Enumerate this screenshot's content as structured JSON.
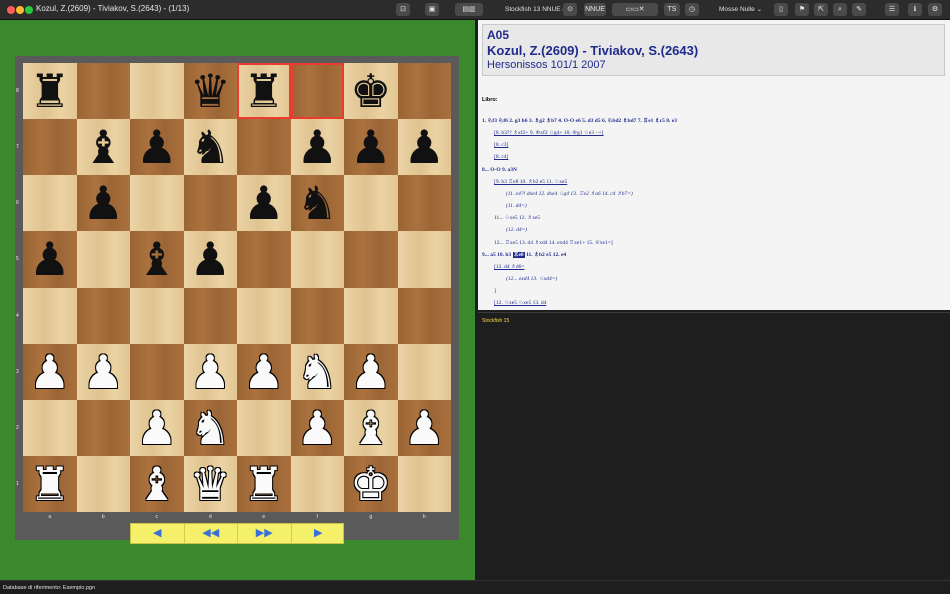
{
  "window": {
    "title": "Kozul, Z.(2609) - Tiviakov, S.(2643) - (1/13)"
  },
  "toolbar": {
    "engine_select": "Stockfish 13 NNUE ◇",
    "nnue_label": "NNUE",
    "ts_label": "TS",
    "mode_select": "Mosse Nulle ⌄"
  },
  "board": {
    "files": [
      "a",
      "b",
      "c",
      "d",
      "e",
      "f",
      "g",
      "h"
    ],
    "ranks": [
      "8",
      "7",
      "6",
      "5",
      "4",
      "3",
      "2",
      "1"
    ],
    "highlight_squares": [
      "e8",
      "f8"
    ],
    "pieces": [
      {
        "sq": "a8",
        "color": "b",
        "glyph": "♜",
        "name": "black-rook-icon"
      },
      {
        "sq": "d8",
        "color": "b",
        "glyph": "♛",
        "name": "black-queen-icon"
      },
      {
        "sq": "e8",
        "color": "b",
        "glyph": "♜",
        "name": "black-rook-icon"
      },
      {
        "sq": "g8",
        "color": "b",
        "glyph": "♚",
        "name": "black-king-icon"
      },
      {
        "sq": "b7",
        "color": "b",
        "glyph": "♝",
        "name": "black-bishop-icon"
      },
      {
        "sq": "c7",
        "color": "b",
        "glyph": "♟",
        "name": "black-pawn-icon"
      },
      {
        "sq": "d7",
        "color": "b",
        "glyph": "♞",
        "name": "black-knight-icon"
      },
      {
        "sq": "f7",
        "color": "b",
        "glyph": "♟",
        "name": "black-pawn-icon"
      },
      {
        "sq": "g7",
        "color": "b",
        "glyph": "♟",
        "name": "black-pawn-icon"
      },
      {
        "sq": "h7",
        "color": "b",
        "glyph": "♟",
        "name": "black-pawn-icon"
      },
      {
        "sq": "b6",
        "color": "b",
        "glyph": "♟",
        "name": "black-pawn-icon"
      },
      {
        "sq": "e6",
        "color": "b",
        "glyph": "♟",
        "name": "black-pawn-icon"
      },
      {
        "sq": "f6",
        "color": "b",
        "glyph": "♞",
        "name": "black-knight-icon"
      },
      {
        "sq": "a5",
        "color": "b",
        "glyph": "♟",
        "name": "black-pawn-icon"
      },
      {
        "sq": "c5",
        "color": "b",
        "glyph": "♝",
        "name": "black-bishop-icon"
      },
      {
        "sq": "d5",
        "color": "b",
        "glyph": "♟",
        "name": "black-pawn-icon"
      },
      {
        "sq": "a3",
        "color": "w",
        "glyph": "♟",
        "name": "white-pawn-icon"
      },
      {
        "sq": "b3",
        "color": "w",
        "glyph": "♟",
        "name": "white-pawn-icon"
      },
      {
        "sq": "d3",
        "color": "w",
        "glyph": "♟",
        "name": "white-pawn-icon"
      },
      {
        "sq": "e3",
        "color": "w",
        "glyph": "♟",
        "name": "white-pawn-icon"
      },
      {
        "sq": "f3",
        "color": "w",
        "glyph": "♞",
        "name": "white-knight-icon"
      },
      {
        "sq": "g3",
        "color": "w",
        "glyph": "♟",
        "name": "white-pawn-icon"
      },
      {
        "sq": "c2",
        "color": "w",
        "glyph": "♟",
        "name": "white-pawn-icon"
      },
      {
        "sq": "d2",
        "color": "w",
        "glyph": "♞",
        "name": "white-knight-icon"
      },
      {
        "sq": "f2",
        "color": "w",
        "glyph": "♟",
        "name": "white-pawn-icon"
      },
      {
        "sq": "g2",
        "color": "w",
        "glyph": "♝",
        "name": "white-bishop-icon"
      },
      {
        "sq": "h2",
        "color": "w",
        "glyph": "♟",
        "name": "white-pawn-icon"
      },
      {
        "sq": "a1",
        "color": "w",
        "glyph": "♜",
        "name": "white-rook-icon"
      },
      {
        "sq": "c1",
        "color": "w",
        "glyph": "♝",
        "name": "white-bishop-icon"
      },
      {
        "sq": "d1",
        "color": "w",
        "glyph": "♛",
        "name": "white-queen-icon"
      },
      {
        "sq": "e1",
        "color": "w",
        "glyph": "♜",
        "name": "white-rook-icon"
      },
      {
        "sq": "g1",
        "color": "w",
        "glyph": "♚",
        "name": "white-king-icon"
      }
    ]
  },
  "nav": {
    "prev": "◀",
    "first": "◀◀",
    "last": "▶▶",
    "next": "▶"
  },
  "game": {
    "eco": "A05",
    "players": "Kozul, Z.(2609) - Tiviakov, S.(2643)",
    "event": "Hersonissos 101/1 2007",
    "libro": "Libro:",
    "lines": [
      {
        "text": "1. ♘f3 ♘f6 2. g3 b6 3. ♗g2 ♗b7 4. O-O e6 5. d3 d5 6. ♘bd2 ♗bd7 7. ♖e1 ♗c5 8. e3",
        "cls": "main",
        "indent": 0
      },
      {
        "text": "[8. b3?? ♗xf2+ 9. ♔xf2 ♘g4+ 10. ♔g1 ♘e3 −+]",
        "cls": "var",
        "indent": 12
      },
      {
        "text": "[8. c3]",
        "cls": "var",
        "indent": 12
      },
      {
        "text": "[8. c4]",
        "cls": "var",
        "indent": 12
      },
      {
        "text": "8... O-O 9. a3N",
        "cls": "main",
        "indent": 0
      },
      {
        "text": "[9. b3 ♖e8 10. ♗b2 e5 11. ♘xe5",
        "cls": "var",
        "indent": 12
      },
      {
        "text": "(11. e4?! dxe4 12. dxe4 ♘g4 13. ♖e2 ♗a6 14. c4 ♗b7=)",
        "cls": "it",
        "indent": 24
      },
      {
        "text": "(11. d4=)",
        "cls": "it",
        "indent": 24
      },
      {
        "text": "11... ♘xe5 12. ♗xe5",
        "cls": "plain",
        "indent": 12
      },
      {
        "text": "(12. d4=)",
        "cls": "it",
        "indent": 24
      },
      {
        "text": "12... ♖xe5 13. d4 ♗xd4 14. exd4 ♖xe1+ 15. ♕xe1=]",
        "cls": "plain",
        "indent": 12
      },
      {
        "text": "9... a5 10. b3 ",
        "cur": "♖e8",
        "after": " 11. ♗b2 e5 12. e4",
        "cls": "main",
        "indent": 0
      },
      {
        "text": "[12. d4 ♗d6=",
        "cls": "var",
        "indent": 12
      },
      {
        "text": "(12... exd4 13. ♘xd4=)",
        "cls": "it",
        "indent": 24
      },
      {
        "text": "]",
        "cls": "plain",
        "indent": 12
      },
      {
        "text": "[12. ♘xe5 ♘xe5 13. d4",
        "cls": "var",
        "indent": 12
      }
    ]
  },
  "engine": {
    "name": "Stockfish 15"
  },
  "status": {
    "text": "Database di riferimento: Esempio.pgn"
  }
}
